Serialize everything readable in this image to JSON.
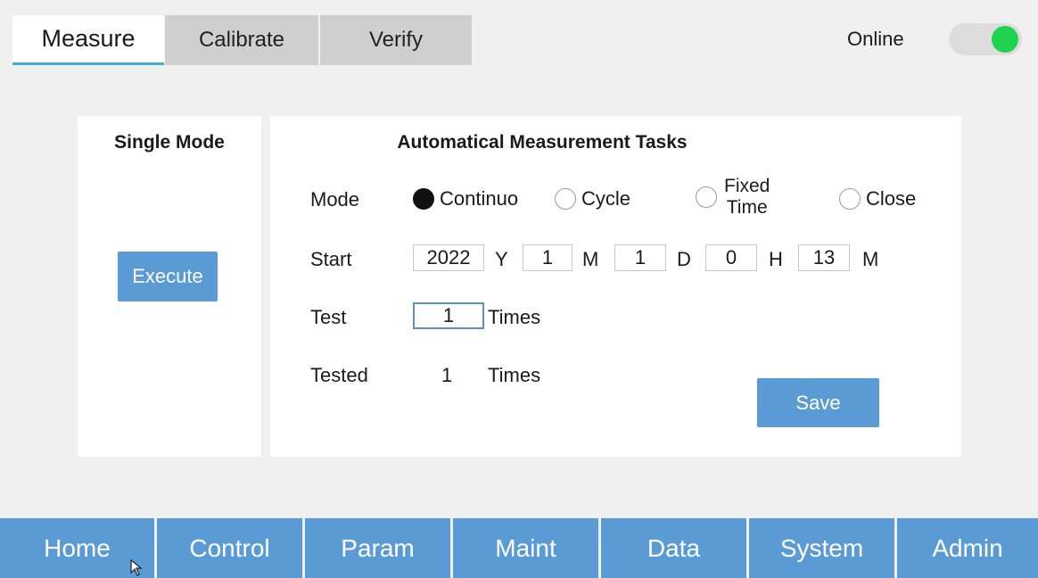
{
  "tabs": {
    "measure": "Measure",
    "calibrate": "Calibrate",
    "verify": "Verify"
  },
  "status": {
    "online_label": "Online",
    "online": true,
    "toggle_color": "#1fd34f"
  },
  "single_mode": {
    "title": "Single Mode",
    "execute_label": "Execute"
  },
  "auto_tasks": {
    "title": "Automatical Measurement Tasks",
    "mode_label": "Mode",
    "mode_options": {
      "continuo": "Continuo",
      "cycle": "Cycle",
      "fixed_line1": "Fixed",
      "fixed_line2": "Time",
      "close": "Close"
    },
    "selected_mode": "Continuo",
    "start_label": "Start",
    "start": {
      "year": "2022",
      "year_unit": "Y",
      "month": "1",
      "month_unit": "M",
      "day": "1",
      "day_unit": "D",
      "hour": "0",
      "hour_unit": "H",
      "minute": "13",
      "minute_unit": "M"
    },
    "test_label": "Test",
    "test_value": "1",
    "test_unit": "Times",
    "tested_label": "Tested",
    "tested_value": "1",
    "tested_unit": "Times",
    "save_label": "Save"
  },
  "nav": {
    "home": "Home",
    "control": "Control",
    "param": "Param",
    "maint": "Maint",
    "data": "Data",
    "system": "System",
    "admin": "Admin"
  },
  "colors": {
    "accent_blue": "#5b9bd5",
    "tab_underline": "#3bb0cf"
  }
}
